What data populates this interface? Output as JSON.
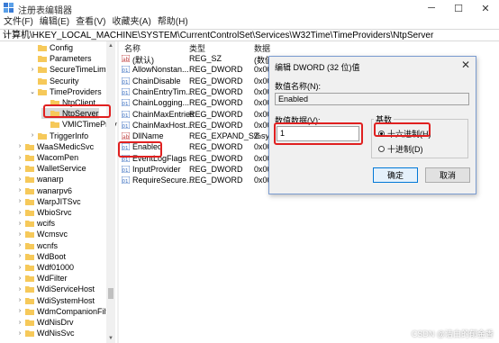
{
  "window": {
    "title": "注册表编辑器",
    "controls": [
      "─",
      "☐",
      "✕"
    ]
  },
  "menu": [
    "文件(F)",
    "编辑(E)",
    "查看(V)",
    "收藏夹(A)",
    "帮助(H)"
  ],
  "address": "计算机\\HKEY_LOCAL_MACHINE\\SYSTEM\\CurrentControlSet\\Services\\W32Time\\TimeProviders\\NtpServer",
  "tree": {
    "items": [
      {
        "label": "Config",
        "expander": ""
      },
      {
        "label": "Parameters",
        "expander": ""
      },
      {
        "label": "SecureTimeLimits",
        "expander": "›"
      },
      {
        "label": "Security",
        "expander": ""
      },
      {
        "label": "TimeProviders",
        "expander": "⌄"
      },
      {
        "label": "NtpClient",
        "expander": ""
      },
      {
        "label": "NtpServer",
        "expander": "",
        "selected": true
      },
      {
        "label": "VMICTimeProv",
        "expander": ""
      },
      {
        "label": "TriggerInfo",
        "expander": "›"
      },
      {
        "label": "WaaSMedicSvc",
        "expander": "›"
      },
      {
        "label": "WacomPen",
        "expander": "›"
      },
      {
        "label": "WalletService",
        "expander": "›"
      },
      {
        "label": "wanarp",
        "expander": "›"
      },
      {
        "label": "wanarpv6",
        "expander": "›"
      },
      {
        "label": "WarpJITSvc",
        "expander": "›"
      },
      {
        "label": "WbioSrvc",
        "expander": "›"
      },
      {
        "label": "wcifs",
        "expander": "›"
      },
      {
        "label": "Wcmsvc",
        "expander": "›"
      },
      {
        "label": "wcnfs",
        "expander": "›"
      },
      {
        "label": "WdBoot",
        "expander": "›"
      },
      {
        "label": "Wdf01000",
        "expander": "›"
      },
      {
        "label": "WdFilter",
        "expander": "›"
      },
      {
        "label": "WdiServiceHost",
        "expander": "›"
      },
      {
        "label": "WdiSystemHost",
        "expander": "›"
      },
      {
        "label": "WdmCompanionFilt",
        "expander": "›"
      },
      {
        "label": "WdNisDrv",
        "expander": "›"
      },
      {
        "label": "WdNisSvc",
        "expander": "›"
      }
    ]
  },
  "list": {
    "headers": {
      "name": "名称",
      "type": "类型",
      "data": "数据"
    },
    "rows": [
      {
        "name": "(默认)",
        "type": "REG_SZ",
        "data": "(数值",
        "icon": "string"
      },
      {
        "name": "AllowNonstan...",
        "type": "REG_DWORD",
        "data": "0x00",
        "icon": "binary"
      },
      {
        "name": "ChainDisable",
        "type": "REG_DWORD",
        "data": "0x00",
        "icon": "binary"
      },
      {
        "name": "ChainEntryTim...",
        "type": "REG_DWORD",
        "data": "0x00",
        "icon": "binary"
      },
      {
        "name": "ChainLogging...",
        "type": "REG_DWORD",
        "data": "0x00",
        "icon": "binary"
      },
      {
        "name": "ChainMaxEntries",
        "type": "REG_DWORD",
        "data": "0x00",
        "icon": "binary"
      },
      {
        "name": "ChainMaxHost...",
        "type": "REG_DWORD",
        "data": "0x00",
        "icon": "binary"
      },
      {
        "name": "DllName",
        "type": "REG_EXPAND_SZ",
        "data": "%sy",
        "icon": "string"
      },
      {
        "name": "Enabled",
        "type": "REG_DWORD",
        "data": "0x00",
        "icon": "binary"
      },
      {
        "name": "EventLogFlags",
        "type": "REG_DWORD",
        "data": "0x00",
        "icon": "binary"
      },
      {
        "name": "InputProvider",
        "type": "REG_DWORD",
        "data": "0x00",
        "icon": "binary"
      },
      {
        "name": "RequireSecure...",
        "type": "REG_DWORD",
        "data": "0x00",
        "icon": "binary"
      }
    ]
  },
  "dialog": {
    "title": "编辑 DWORD (32 位)值",
    "close": "✕",
    "name_label": "数值名称(N):",
    "name_value": "Enabled",
    "data_label": "数值数据(V):",
    "data_value": "1",
    "base_label": "基数",
    "radix_hex": "十六进制(H)",
    "radix_dec": "十进制(D)",
    "radix_selected": "hex",
    "ok": "确定",
    "cancel": "取消"
  },
  "watermark": "CSDN @洁白的郁金香",
  "colors": {
    "highlight": "#e02020",
    "folder": "#f6c95a",
    "accent": "#0078d7"
  }
}
